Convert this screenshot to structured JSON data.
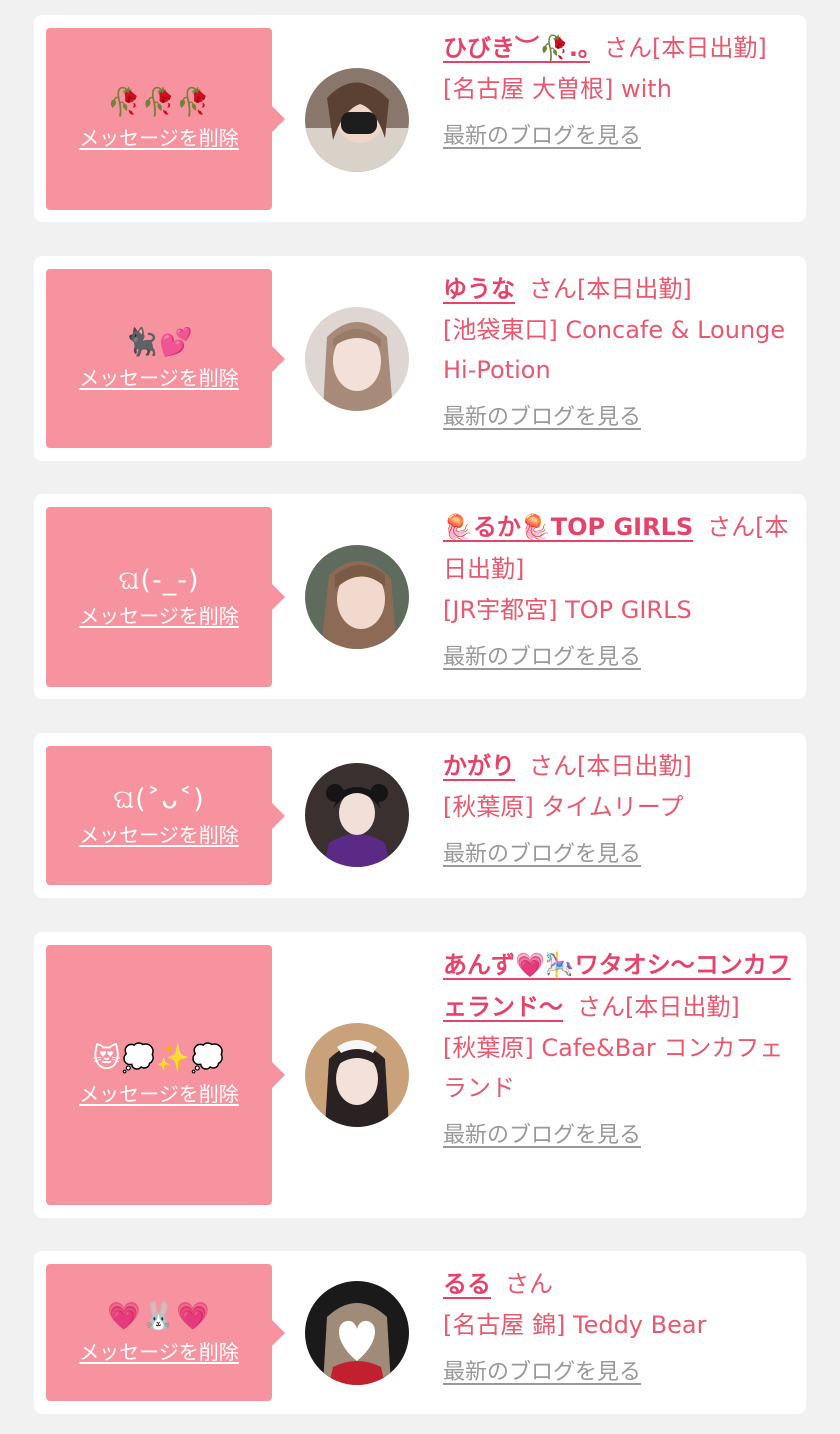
{
  "favorites": [
    {
      "message": "🥀🥀🥀",
      "delete_label": "メッセージを削除",
      "name": "ひびき︶🥀.｡",
      "honorific": "さん",
      "status": "[本日出勤]",
      "shop": "[名古屋 大曽根] with",
      "blog_link": "最新のブログを見る"
    },
    {
      "message": "🐈‍⬛💕",
      "delete_label": "メッセージを削除",
      "name": "ゆうな",
      "honorific": "さん",
      "status": "[本日出勤]",
      "shop": "[池袋東口] Concafe & Lounge Hi-Potion",
      "blog_link": "最新のブログを見る"
    },
    {
      "message": "ଘ(-_-)",
      "delete_label": "メッセージを削除",
      "name": "🪼るか🪼TOP GIRLS",
      "honorific": "さん",
      "status": "[本日出勤]",
      "shop": "[JR宇都宮] TOP GIRLS",
      "blog_link": "最新のブログを見る"
    },
    {
      "message": "ଘ(˃ᴗ˂)",
      "delete_label": "メッセージを削除",
      "name": "かがり",
      "honorific": "さん",
      "status": "[本日出勤]",
      "shop": "[秋葉原] タイムリープ",
      "blog_link": "最新のブログを見る"
    },
    {
      "message": "😻💭✨💭",
      "delete_label": "メッセージを削除",
      "name": "あんず💗🎠ワタオシ〜コンカフェランド〜",
      "honorific": "さん",
      "status": "[本日出勤]",
      "shop": "[秋葉原] Cafe&Bar コンカフェランド",
      "blog_link": "最新のブログを見る"
    },
    {
      "message": "💗🐰💗",
      "delete_label": "メッセージを削除",
      "name": "るる",
      "honorific": "さん",
      "status": "",
      "shop": "[名古屋 錦] Teddy Bear",
      "blog_link": "最新のブログを見る"
    }
  ],
  "colors": {
    "page_bg": "#f1f1f1",
    "card_bg": "#ffffff",
    "bubble_bg": "#f7929f",
    "accent_pink": "#e6436b",
    "link_gray": "#999999"
  }
}
